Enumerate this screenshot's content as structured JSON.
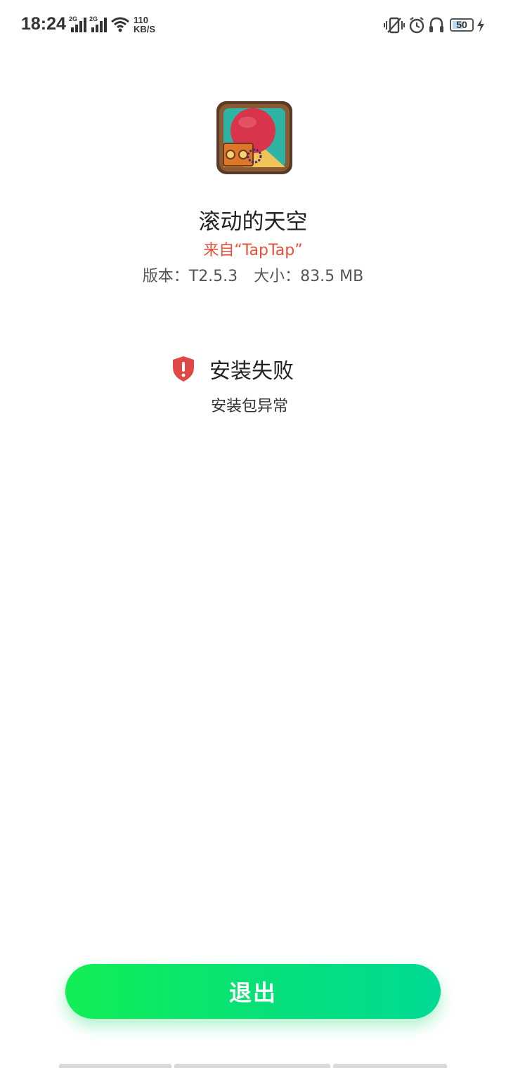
{
  "status_bar": {
    "time": "18:24",
    "sim1_tag": "2G",
    "sim2_tag": "2G",
    "net_speed_value": "110",
    "net_speed_unit": "KB/S",
    "battery_level": "50",
    "icons": [
      "signal-icon",
      "signal-icon",
      "wifi-icon",
      "vibrate-icon",
      "alarm-icon",
      "headphones-icon",
      "battery-icon",
      "charging-bolt-icon"
    ]
  },
  "app": {
    "name": "滚动的天空",
    "source": "来自“TapTap”",
    "version_label": "版本：T2.5.3",
    "size_label": "大小：83.5 MB",
    "icon": "app-icon"
  },
  "install_status": {
    "title": "安装失败",
    "reason": "安装包异常",
    "icon": "shield-alert-icon",
    "color": "#e04848"
  },
  "actions": {
    "exit_label": "退出",
    "accent_start": "#12ef55",
    "accent_end": "#00da94"
  }
}
